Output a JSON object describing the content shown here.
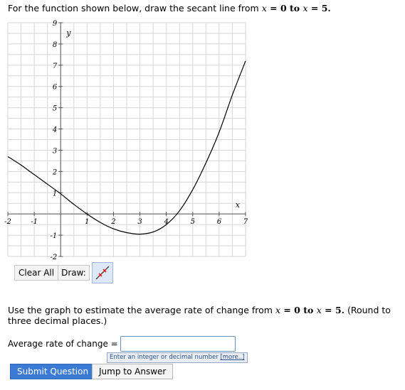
{
  "question": {
    "prefix": "For the function shown below, draw the secant line from ",
    "var1": "x",
    "eq1": " = 0 to ",
    "var2": "x",
    "eq2": " = 5."
  },
  "graph": {
    "x_axis_label": "x",
    "y_axis_label": "y",
    "x_ticks": [
      "-2",
      "-1",
      "1",
      "2",
      "3",
      "4",
      "5",
      "6",
      "7"
    ],
    "y_ticks": [
      "9",
      "8",
      "7",
      "6",
      "5",
      "4",
      "3",
      "2",
      "1",
      "-1",
      "-2"
    ]
  },
  "chart_data": {
    "type": "line",
    "xlabel": "x",
    "ylabel": "y",
    "xlim": [
      -2,
      7
    ],
    "ylim": [
      -2,
      9
    ],
    "grid": true,
    "series": [
      {
        "x": [
          -2,
          -1.5,
          -1,
          -0.5,
          0,
          0.5,
          1,
          1.5,
          2,
          2.5,
          3,
          3.5,
          4,
          4.5,
          5,
          5.5,
          6,
          6.5,
          7
        ],
        "y": [
          2.7,
          2.3,
          1.85,
          1.4,
          0.95,
          0.45,
          0.0,
          -0.4,
          -0.7,
          -0.88,
          -0.95,
          -0.85,
          -0.5,
          0.15,
          1.15,
          2.4,
          3.85,
          5.6,
          7.2
        ]
      }
    ]
  },
  "toolbar": {
    "clear_label": "Clear All",
    "draw_label": "Draw:"
  },
  "question2": {
    "prefix": "Use the graph to estimate the average rate of change from ",
    "var1": "x",
    "eq1": " = 0 to ",
    "var2": "x",
    "eq2": " = 5.",
    "suffix": " (Round to three decimal places.)"
  },
  "answer": {
    "label": "Average rate of change =",
    "value": "",
    "hint": "Enter an integer or decimal number",
    "hint_more": "[more..]"
  },
  "buttons": {
    "submit": "Submit Question",
    "jump": "Jump to Answer"
  },
  "colors": {
    "accent": "#3c7bd4",
    "grid": "#d6d6d6",
    "curve": "#000000"
  }
}
